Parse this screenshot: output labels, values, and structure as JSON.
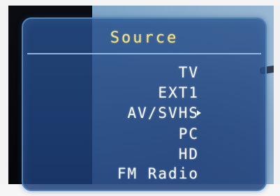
{
  "menu": {
    "title": "Source",
    "items": [
      {
        "label": "TV"
      },
      {
        "label": "EXT1"
      },
      {
        "label": "AV/SVHS",
        "submenu_icon": "right-triangle-icon"
      },
      {
        "label": "PC"
      },
      {
        "label": "HD"
      },
      {
        "label": "FM Radio"
      }
    ]
  },
  "colors": {
    "title": "#f2e27c",
    "item_text": "#f1f6ff",
    "menu_border": "#4f82b9",
    "menu_background": "#28508c"
  }
}
